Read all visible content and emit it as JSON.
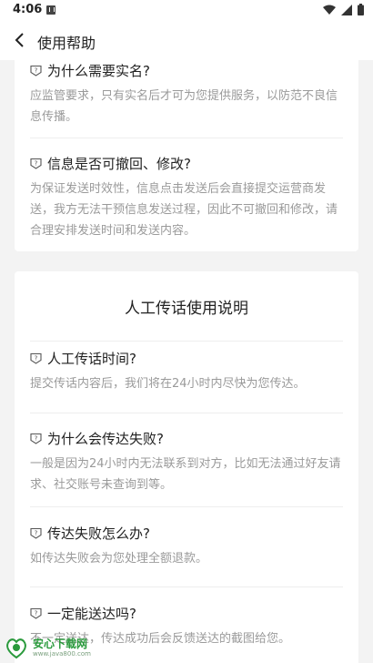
{
  "status": {
    "time": "4:06"
  },
  "appbar": {
    "title": "使用帮助"
  },
  "section1": {
    "items": [
      {
        "q": "为什么需要实名?",
        "a": "应监管要求，只有实名后才可为您提供服务，以防范不良信息传播。"
      },
      {
        "q": "信息是否可撤回、修改?",
        "a": "为保证发送时效性，信息点击发送后会直接提交运营商发送，我方无法干预信息发送过程，因此不可撤回和修改，请合理安排发送时间和发送内容。"
      }
    ]
  },
  "section2": {
    "title": "人工传话使用说明",
    "items": [
      {
        "q": "人工传话时间?",
        "a": "提交传话内容后，我们将在24小时内尽快为您传达。"
      },
      {
        "q": "为什么会传达失败?",
        "a": "一般是因为24小时内无法联系到对方，比如无法通过好友请求、社交账号未查询到等。"
      },
      {
        "q": "传达失败怎么办?",
        "a": "如传达失败会为您处理全额退款。"
      },
      {
        "q": "一定能送达吗?",
        "a": "不一定送达，传达成功后会反馈送达的截图给您。"
      }
    ]
  },
  "watermark": {
    "title": "安心下载网",
    "url": "www.java800.com"
  },
  "colors": {
    "question_icon": "#555555",
    "answer_text": "#9a9a9a",
    "watermark_green": "#2a9a3c"
  }
}
